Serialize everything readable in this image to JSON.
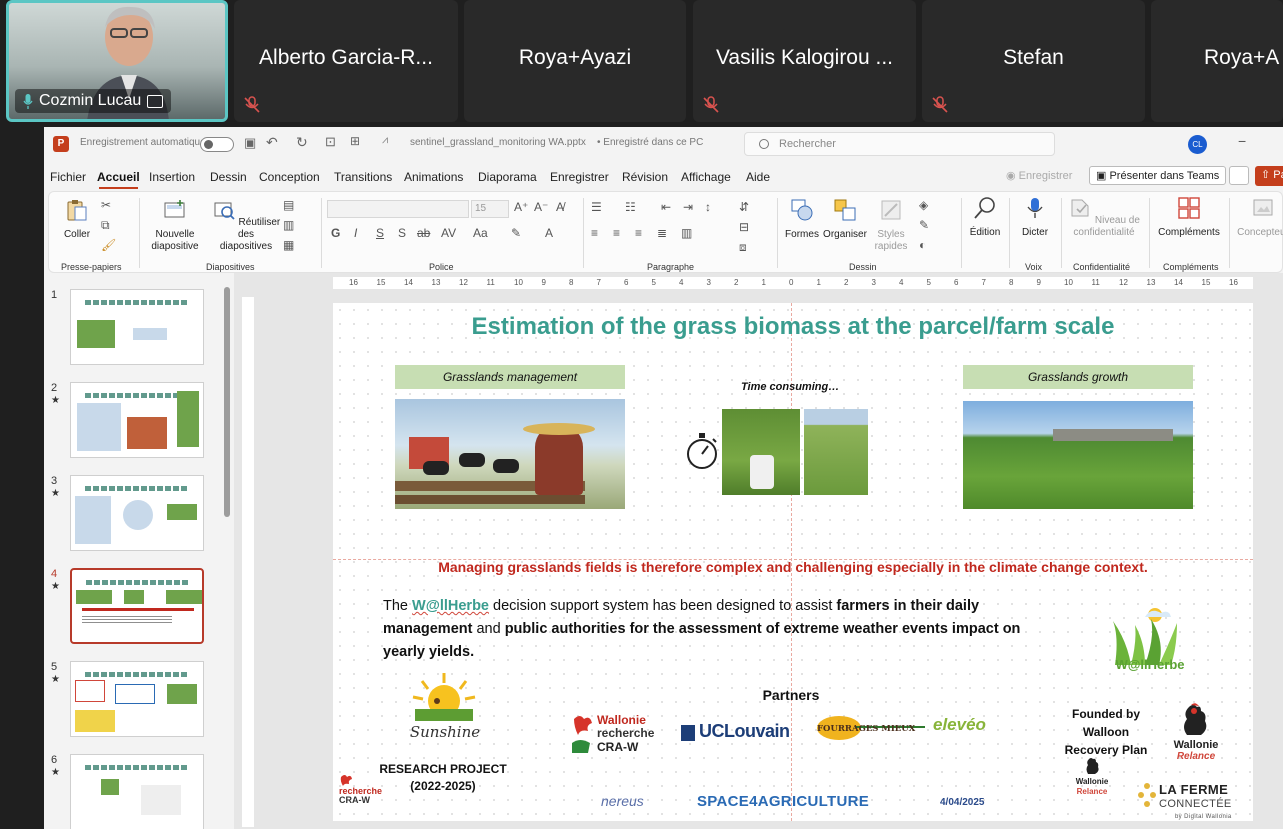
{
  "teams": {
    "self": {
      "name": "Cozmin Lucau"
    },
    "participants": [
      {
        "name": "Alberto Garcia-R..."
      },
      {
        "name": "Roya+Ayazi"
      },
      {
        "name": "Vasilis Kalogirou ..."
      },
      {
        "name": "Stefan"
      },
      {
        "name": "Roya+A"
      }
    ]
  },
  "ppt": {
    "titlebar": {
      "app_letter": "P",
      "autosave_label": "Enregistrement automatique",
      "file_name": "sentinel_grassland_monitoring WA.pptx",
      "save_status": "• Enregistré dans ce PC",
      "search_placeholder": "Rechercher",
      "user_initials": "CL"
    },
    "tabs": [
      "Fichier",
      "Accueil",
      "Insertion",
      "Dessin",
      "Conception",
      "Transitions",
      "Animations",
      "Diaporama",
      "Enregistrer",
      "Révision",
      "Affichage",
      "Aide"
    ],
    "active_tab": "Accueil",
    "right_actions": {
      "record": "Enregistrer",
      "present_teams": "Présenter dans Teams",
      "share": "Pa"
    },
    "ribbon": {
      "paste": "Coller",
      "new_slide_1": "Nouvelle",
      "new_slide_2": "diapositive",
      "reuse_1": "Réutiliser des",
      "reuse_2": "diapositives",
      "font_size": "15",
      "shapes": "Formes",
      "arrange": "Organiser",
      "quick_styles_1": "Styles",
      "quick_styles_2": "rapides",
      "editing": "Édition",
      "dictate": "Dicter",
      "sensitivity_1": "Niveau de",
      "sensitivity_2": "confidentialité",
      "addins": "Compléments",
      "designer": "Concepteur",
      "groups": {
        "clipboard": "Presse-papiers",
        "slides": "Diapositives",
        "font": "Police",
        "paragraph": "Paragraphe",
        "drawing": "Dessin",
        "voice": "Voix",
        "sensitivity": "Confidentialité",
        "addins": "Compléments"
      },
      "font_buttons": [
        "G",
        "I",
        "S",
        "S",
        "ab",
        "AV",
        "Aa"
      ]
    },
    "ruler_marks": [
      "16",
      "15",
      "14",
      "13",
      "12",
      "11",
      "10",
      "9",
      "8",
      "7",
      "6",
      "5",
      "4",
      "3",
      "2",
      "1",
      "0",
      "1",
      "2",
      "3",
      "4",
      "5",
      "6",
      "7",
      "8",
      "9",
      "10",
      "11",
      "12",
      "13",
      "14",
      "15",
      "16"
    ],
    "thumbnails": [
      {
        "num": "1",
        "star": ""
      },
      {
        "num": "2",
        "star": "★"
      },
      {
        "num": "3",
        "star": "★"
      },
      {
        "num": "4",
        "star": "★"
      },
      {
        "num": "5",
        "star": "★"
      },
      {
        "num": "6",
        "star": "★"
      }
    ],
    "selected_slide": 4,
    "slide": {
      "title": "Estimation of the grass biomass at the parcel/farm scale",
      "box_management": "Grasslands management",
      "time_consuming": "Time consuming…",
      "box_growth": "Grasslands growth",
      "red_statement": "Managing grasslands fields is therefore complex and challenging especially in the climate change context.",
      "para": {
        "p1": "The ",
        "name": "W@llHerbe",
        "p2": " decision support system has been designed to assist ",
        "b1": "farmers in their daily management",
        "p3": " and ",
        "b2": "public authorities for the assessment of extreme weather events impact on yearly yields."
      },
      "wallherbe_logo_text": "W@llHerbe",
      "sunshine_text": "Sunshine",
      "research_project_1": "RESEARCH PROJECT",
      "research_project_2": "(2022-2025)",
      "partners_title": "Partners",
      "wallonie_recherche_1": "Wallonie",
      "wallonie_recherche_2": "recherche",
      "wallonie_recherche_3": "CRA-W",
      "uclouvain": "UCLouvain",
      "fourrages": "FOURRAGES MIEUX",
      "eleveo": "elevéo",
      "founded_1": "Founded by",
      "founded_2": "Walloon",
      "founded_3": "Recovery Plan",
      "wallonie_relance_1": "Wallonie",
      "wallonie_relance_2": "Relance",
      "footer_cra_1": "recherche",
      "footer_cra_2": "CRA-W",
      "nereus": "nereus",
      "space4agriculture": "SPACE4AGRICULTURE",
      "date": "4/04/2025",
      "footer_wallonie_1": "Wallonie",
      "footer_wallonie_2": "Relance",
      "ferme_1": "LA FERME",
      "ferme_2": "CONNECTÉE",
      "ferme_3": "by Digital Wallonia"
    }
  },
  "colors": {
    "teams_bg": "#1f1f1f",
    "tile_bg": "#292929",
    "active_border": "#5bc6c4",
    "ppt_accent": "#c43e1c",
    "title_teal": "#3a9d8f",
    "red_text": "#c0281e"
  }
}
